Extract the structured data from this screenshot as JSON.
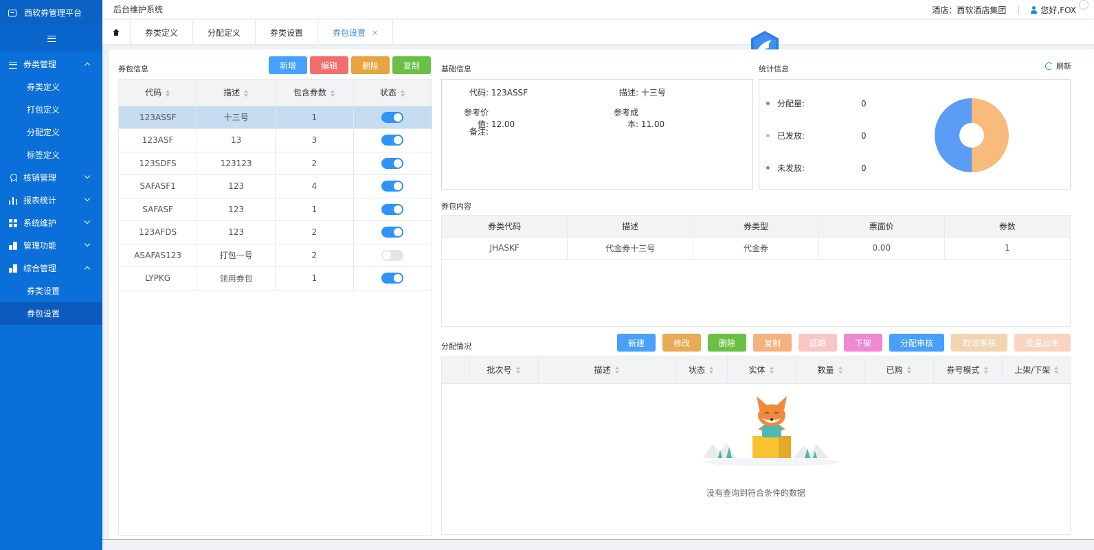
{
  "sidebar": {
    "brand": "西软券管理平台",
    "groups": [
      {
        "label": "券类管理",
        "icon": "list-icon",
        "expanded": true,
        "items": [
          "券类定义",
          "打包定义",
          "分配定义",
          "标签定义"
        ]
      },
      {
        "label": "核销管理",
        "icon": "medal-icon",
        "expanded": false
      },
      {
        "label": "报表统计",
        "icon": "bar-chart-icon",
        "expanded": false
      },
      {
        "label": "系统维护",
        "icon": "grid-icon",
        "expanded": false
      },
      {
        "label": "管理功能",
        "icon": "building-icon",
        "expanded": false
      },
      {
        "label": "综合管理",
        "icon": "building-icon",
        "expanded": true,
        "items": [
          "券类设置",
          "券包设置"
        ]
      }
    ],
    "active_item": "券包设置"
  },
  "topbar": {
    "title": "后台维护系统",
    "hotel": "酒店：西软酒店集团",
    "sep": "|",
    "user": "您好,FOX"
  },
  "tabs": [
    {
      "label": "券类定义"
    },
    {
      "label": "分配定义"
    },
    {
      "label": "券类设置"
    },
    {
      "label": "券包设置",
      "active": true,
      "close": "×"
    }
  ],
  "packages": {
    "title": "券包信息",
    "buttons": {
      "add": "新增",
      "edit": "编辑",
      "delete": "删除",
      "copy": "复制"
    },
    "columns": [
      "代码",
      "描述",
      "包含券数",
      "状态"
    ],
    "rows": [
      {
        "code": "123ASSF",
        "desc": "十三号",
        "count": "1",
        "enabled": true,
        "selected": true
      },
      {
        "code": "123ASF",
        "desc": "13",
        "count": "3",
        "enabled": true
      },
      {
        "code": "123SDFS",
        "desc": "123123",
        "count": "2",
        "enabled": true
      },
      {
        "code": "SAFASF1",
        "desc": "123",
        "count": "4",
        "enabled": true
      },
      {
        "code": "SAFASF",
        "desc": "123",
        "count": "1",
        "enabled": true
      },
      {
        "code": "123AFDS",
        "desc": "123",
        "count": "2",
        "enabled": true
      },
      {
        "code": "ASAFAS123",
        "desc": "打包一号",
        "count": "2",
        "enabled": false
      },
      {
        "code": "LYPKG",
        "desc": "领用券包",
        "count": "1",
        "enabled": true
      }
    ]
  },
  "basic": {
    "title": "基础信息",
    "code_label": "代码:",
    "code": "123ASSF",
    "desc_label": "描述:",
    "desc": "十三号",
    "ref_value_label": "参考价值:",
    "ref_value": "12.00",
    "ref_cost_label": "参考成本:",
    "ref_cost": "11.00",
    "note_label": "备注:"
  },
  "stats": {
    "title": "统计信息",
    "refresh": "刷新",
    "rows": [
      {
        "label": "分配量:",
        "value": "0",
        "color": "#e0559a"
      },
      {
        "label": "已发放:",
        "value": "0",
        "color": "#f6b26b"
      },
      {
        "label": "未发放:",
        "value": "0",
        "color": "#4f95f5"
      }
    ],
    "donut_colors": {
      "left": "#5a9cf6",
      "right": "#f8bb7c"
    }
  },
  "content": {
    "title": "券包内容",
    "columns": [
      "券类代码",
      "描述",
      "券类型",
      "票面价",
      "券数"
    ],
    "rows": [
      {
        "code": "JHASKF",
        "desc": "代金券十三号",
        "type": "代金券",
        "price": "0.00",
        "count": "1"
      }
    ]
  },
  "distribution": {
    "title": "分配情况",
    "buttons": [
      "新建",
      "修改",
      "删除",
      "复制",
      "延期",
      "下架",
      "分配审核",
      "取消审核",
      "批量出库"
    ],
    "columns": [
      "批次号",
      "描述",
      "状态",
      "实体",
      "数量",
      "已购",
      "券号模式",
      "上架/下架"
    ],
    "empty": "没有查询到符合条件的数据"
  }
}
